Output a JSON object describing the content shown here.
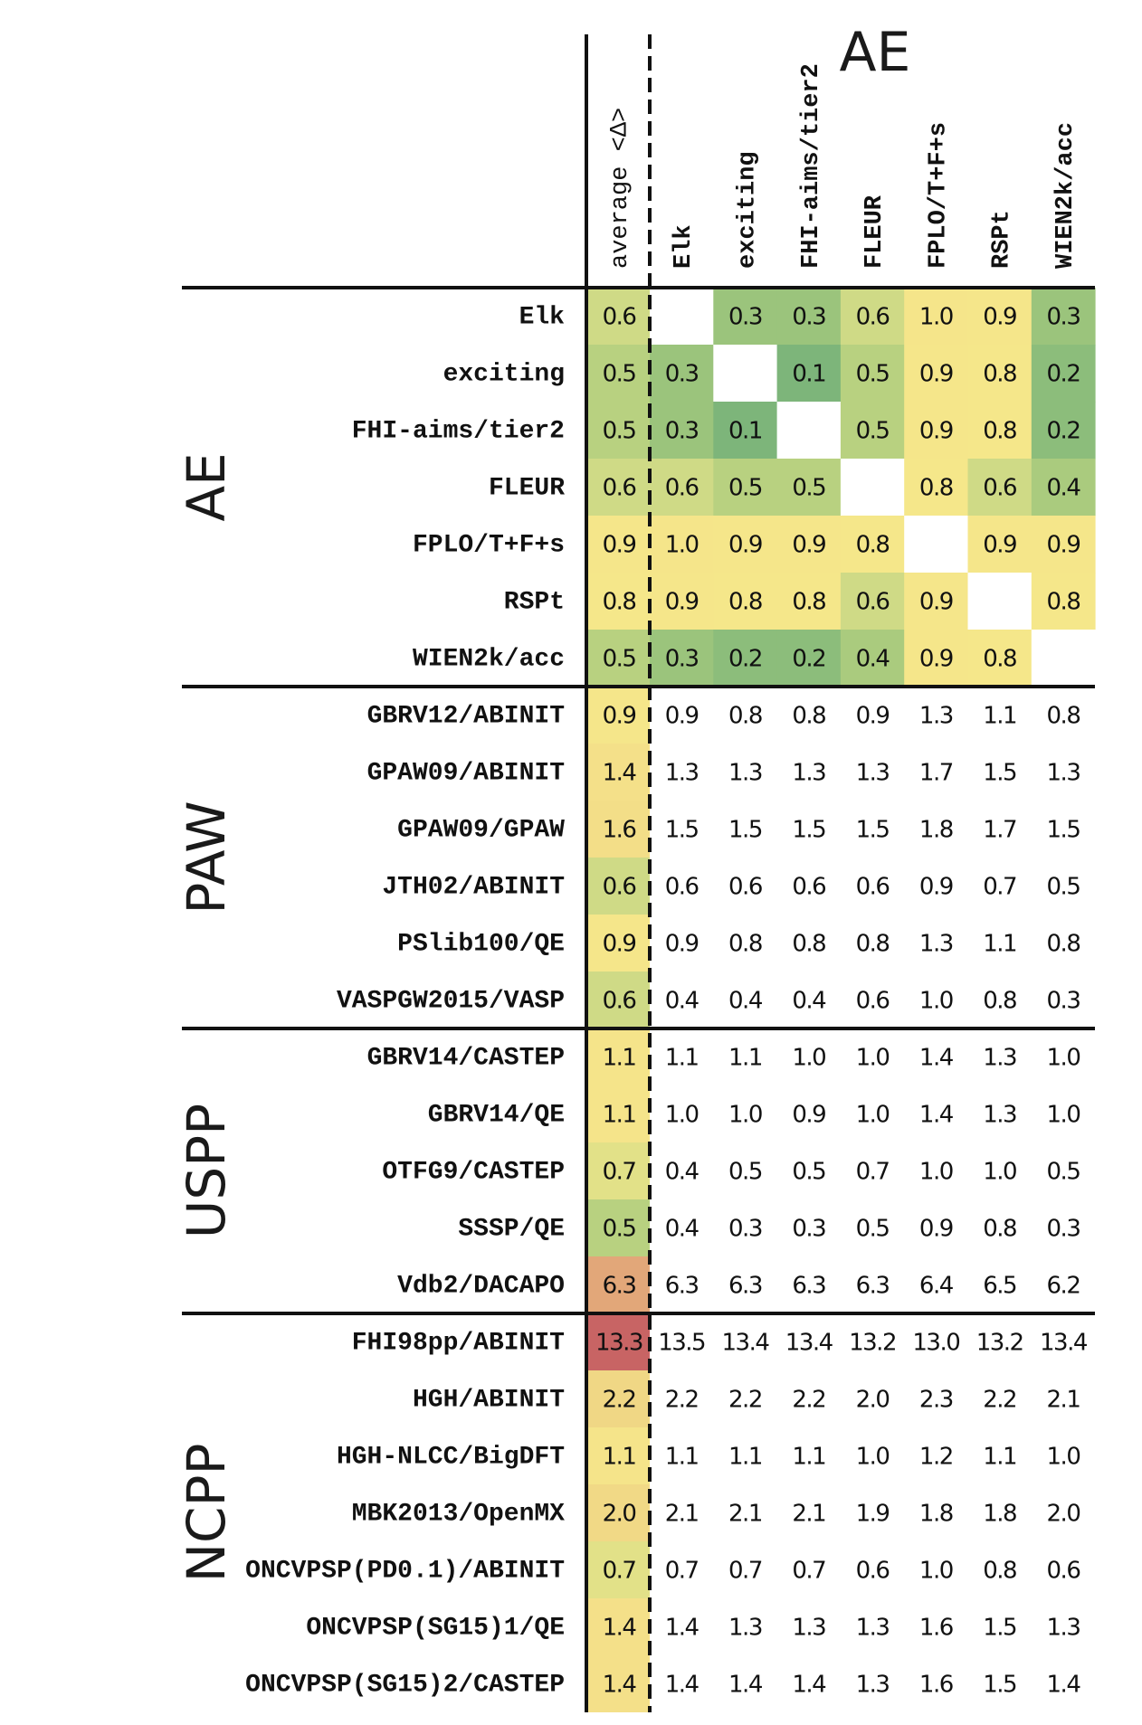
{
  "chart_data": {
    "type": "heatmap",
    "title": "AE",
    "average_column_label": "average <Δ>",
    "columns": [
      "Elk",
      "exciting",
      "FHI-aims/tier2",
      "FLEUR",
      "FPLO/T+F+s",
      "RSPt",
      "WIEN2k/acc"
    ],
    "groups": [
      {
        "name": "AE",
        "colored": true,
        "rows": [
          {
            "label": "Elk",
            "average": 0.6,
            "values": [
              null,
              0.3,
              0.3,
              0.6,
              1.0,
              0.9,
              0.3
            ]
          },
          {
            "label": "exciting",
            "average": 0.5,
            "values": [
              0.3,
              null,
              0.1,
              0.5,
              0.9,
              0.8,
              0.2
            ]
          },
          {
            "label": "FHI-aims/tier2",
            "average": 0.5,
            "values": [
              0.3,
              0.1,
              null,
              0.5,
              0.9,
              0.8,
              0.2
            ]
          },
          {
            "label": "FLEUR",
            "average": 0.6,
            "values": [
              0.6,
              0.5,
              0.5,
              null,
              0.8,
              0.6,
              0.4
            ]
          },
          {
            "label": "FPLO/T+F+s",
            "average": 0.9,
            "values": [
              1.0,
              0.9,
              0.9,
              0.8,
              null,
              0.9,
              0.9
            ]
          },
          {
            "label": "RSPt",
            "average": 0.8,
            "values": [
              0.9,
              0.8,
              0.8,
              0.6,
              0.9,
              null,
              0.8
            ]
          },
          {
            "label": "WIEN2k/acc",
            "average": 0.5,
            "values": [
              0.3,
              0.2,
              0.2,
              0.4,
              0.9,
              0.8,
              null
            ]
          }
        ]
      },
      {
        "name": "PAW",
        "colored": false,
        "rows": [
          {
            "label": "GBRV12/ABINIT",
            "average": 0.9,
            "values": [
              0.9,
              0.8,
              0.8,
              0.9,
              1.3,
              1.1,
              0.8
            ]
          },
          {
            "label": "GPAW09/ABINIT",
            "average": 1.4,
            "values": [
              1.3,
              1.3,
              1.3,
              1.3,
              1.7,
              1.5,
              1.3
            ]
          },
          {
            "label": "GPAW09/GPAW",
            "average": 1.6,
            "values": [
              1.5,
              1.5,
              1.5,
              1.5,
              1.8,
              1.7,
              1.5
            ]
          },
          {
            "label": "JTH02/ABINIT",
            "average": 0.6,
            "values": [
              0.6,
              0.6,
              0.6,
              0.6,
              0.9,
              0.7,
              0.5
            ]
          },
          {
            "label": "PSlib100/QE",
            "average": 0.9,
            "values": [
              0.9,
              0.8,
              0.8,
              0.8,
              1.3,
              1.1,
              0.8
            ]
          },
          {
            "label": "VASPGW2015/VASP",
            "average": 0.6,
            "values": [
              0.4,
              0.4,
              0.4,
              0.6,
              1.0,
              0.8,
              0.3
            ]
          }
        ]
      },
      {
        "name": "USPP",
        "colored": false,
        "rows": [
          {
            "label": "GBRV14/CASTEP",
            "average": 1.1,
            "values": [
              1.1,
              1.1,
              1.0,
              1.0,
              1.4,
              1.3,
              1.0
            ]
          },
          {
            "label": "GBRV14/QE",
            "average": 1.1,
            "values": [
              1.0,
              1.0,
              0.9,
              1.0,
              1.4,
              1.3,
              1.0
            ]
          },
          {
            "label": "OTFG9/CASTEP",
            "average": 0.7,
            "values": [
              0.4,
              0.5,
              0.5,
              0.7,
              1.0,
              1.0,
              0.5
            ]
          },
          {
            "label": "SSSP/QE",
            "average": 0.5,
            "values": [
              0.4,
              0.3,
              0.3,
              0.5,
              0.9,
              0.8,
              0.3
            ]
          },
          {
            "label": "Vdb2/DACAPO",
            "average": 6.3,
            "values": [
              6.3,
              6.3,
              6.3,
              6.3,
              6.4,
              6.5,
              6.2
            ]
          }
        ]
      },
      {
        "name": "NCPP",
        "colored": false,
        "rows": [
          {
            "label": "FHI98pp/ABINIT",
            "average": 13.3,
            "values": [
              13.5,
              13.4,
              13.4,
              13.2,
              13.0,
              13.2,
              13.4
            ]
          },
          {
            "label": "HGH/ABINIT",
            "average": 2.2,
            "values": [
              2.2,
              2.2,
              2.2,
              2.0,
              2.3,
              2.2,
              2.1
            ]
          },
          {
            "label": "HGH-NLCC/BigDFT",
            "average": 1.1,
            "values": [
              1.1,
              1.1,
              1.1,
              1.0,
              1.2,
              1.1,
              1.0
            ]
          },
          {
            "label": "MBK2013/OpenMX",
            "average": 2.0,
            "values": [
              2.1,
              2.1,
              2.1,
              1.9,
              1.8,
              1.8,
              2.0
            ]
          },
          {
            "label": "ONCVPSP(PD0.1)/ABINIT",
            "average": 0.7,
            "values": [
              0.7,
              0.7,
              0.7,
              0.6,
              1.0,
              0.8,
              0.6
            ]
          },
          {
            "label": "ONCVPSP(SG15)1/QE",
            "average": 1.4,
            "values": [
              1.4,
              1.3,
              1.3,
              1.3,
              1.6,
              1.5,
              1.3
            ]
          },
          {
            "label": "ONCVPSP(SG15)2/CASTEP",
            "average": 1.4,
            "values": [
              1.4,
              1.4,
              1.4,
              1.3,
              1.6,
              1.5,
              1.4
            ]
          }
        ]
      }
    ],
    "colormap": {
      "stops": [
        {
          "value": 0.1,
          "color": "#7db57a"
        },
        {
          "value": 0.3,
          "color": "#9bc47c"
        },
        {
          "value": 0.5,
          "color": "#b8d180"
        },
        {
          "value": 0.6,
          "color": "#cfda86"
        },
        {
          "value": 0.8,
          "color": "#f5e78a"
        },
        {
          "value": 1.1,
          "color": "#f5e48a"
        },
        {
          "value": 2.2,
          "color": "#f0d785"
        },
        {
          "value": 6.3,
          "color": "#e2a779"
        },
        {
          "value": 13.3,
          "color": "#c86464"
        }
      ]
    },
    "value_format": "one decimal",
    "grid": false
  }
}
